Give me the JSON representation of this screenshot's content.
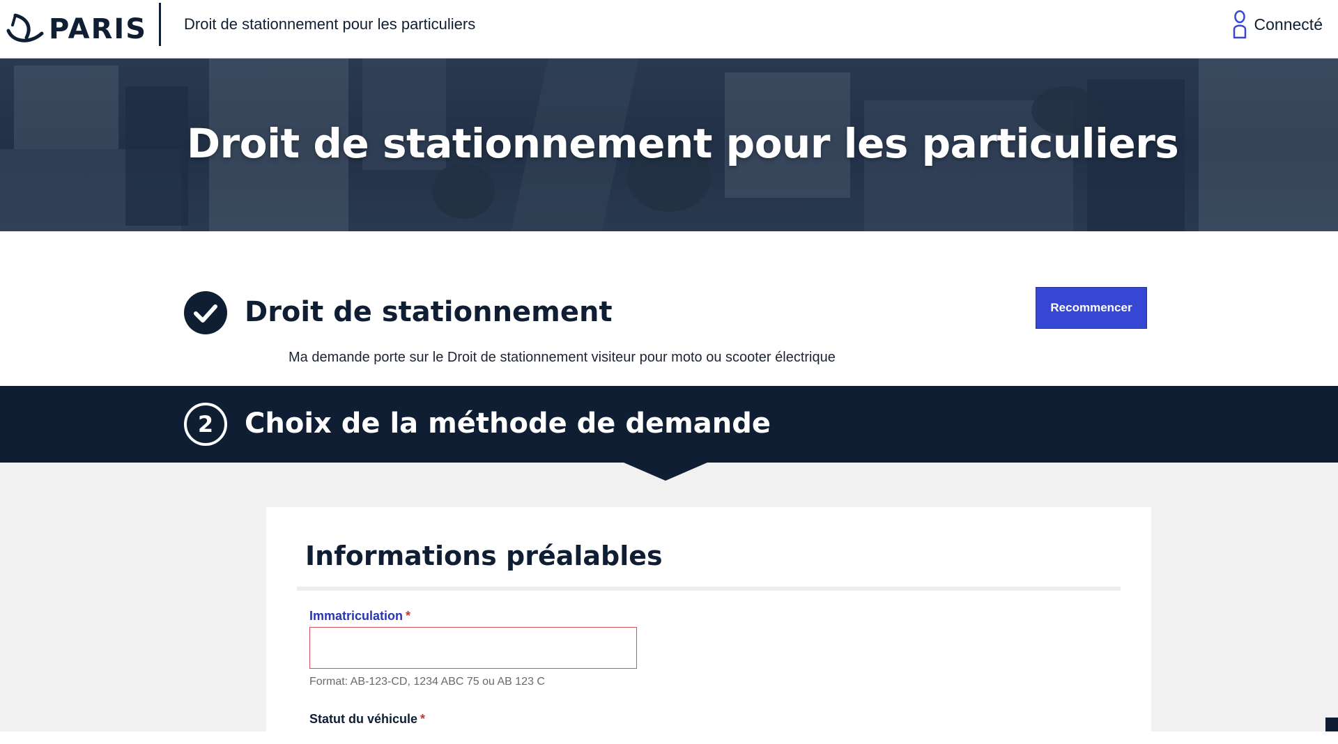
{
  "header": {
    "logo_text": "PARIS",
    "title": "Droit de stationnement pour les particuliers",
    "account_label": "Connecté"
  },
  "hero": {
    "title": "Droit de stationnement pour les particuliers"
  },
  "step1": {
    "title": "Droit de stationnement",
    "restart_label": "Recommencer",
    "description": "Ma demande porte sur le Droit de stationnement visiteur pour moto ou scooter électrique"
  },
  "step2": {
    "number": "2",
    "title": "Choix de la méthode de demande"
  },
  "form": {
    "title": "Informations préalables",
    "plate": {
      "label": "Immatriculation",
      "required_mark": "*",
      "value": "",
      "hint": "Format: AB-123-CD, 1234 ABC 75 ou AB 123 C"
    },
    "vehicle_status": {
      "label": "Statut du véhicule",
      "required_mark": "*"
    }
  },
  "colors": {
    "navy": "#0f1e33",
    "accent_blue": "#3547d3",
    "label_blue": "#2a36b0",
    "error_red": "#d9545a",
    "required_red": "#c0392b"
  }
}
